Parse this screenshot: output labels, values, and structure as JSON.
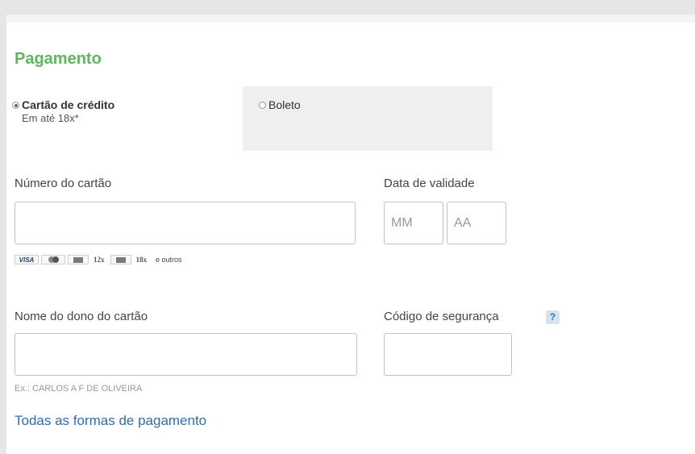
{
  "payment": {
    "title": "Pagamento",
    "tabs": {
      "credit_card": {
        "label": "Cartão de crédito",
        "sublabel": "Em até 18x*",
        "selected": true
      },
      "boleto": {
        "label": "Boleto",
        "selected": false
      }
    },
    "card_number": {
      "label": "Número do cartão",
      "value": "",
      "placeholder": ""
    },
    "expiry": {
      "label": "Data de validade",
      "month_placeholder": "MM",
      "year_placeholder": "AA"
    },
    "brands": {
      "visa": "VISA",
      "installments_a": "12x",
      "installments_b": "18x",
      "others": "e outros"
    },
    "holder_name": {
      "label": "Nome do dono do cartão",
      "value": "",
      "hint": "Ex.: CARLOS A F DE OLIVEIRA"
    },
    "security_code": {
      "label": "Código de segurança",
      "help": "?",
      "value": ""
    },
    "all_methods_link": "Todas as formas de pagamento"
  },
  "colors": {
    "title_green": "#5cb85c",
    "link_blue": "#2f6db5",
    "page_bg": "#e6e6e6"
  }
}
